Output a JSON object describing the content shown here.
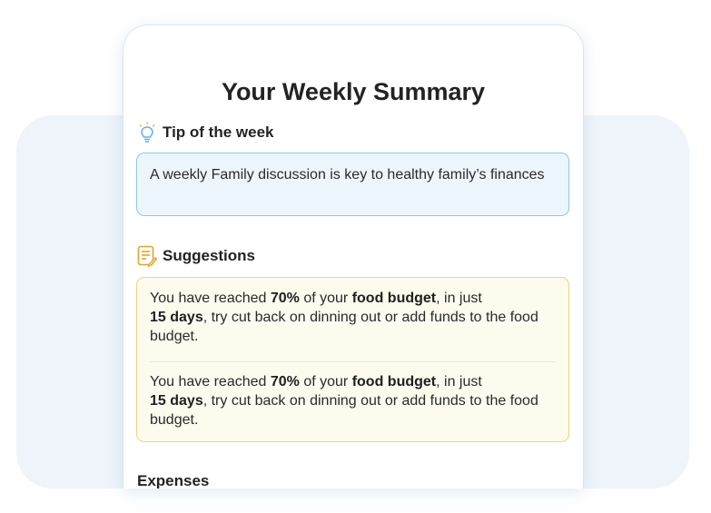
{
  "summary": {
    "title": "Your Weekly Summary"
  },
  "tip": {
    "heading": "Tip of the week",
    "icon": "lightbulb-icon",
    "text": "A weekly Family discussion is key to healthy family’s finances"
  },
  "suggestions": {
    "heading": "Suggestions",
    "icon": "notes-icon",
    "items": [
      {
        "t1": "You have reached ",
        "b1": "70%",
        "t2": " of your ",
        "b2": "food budget",
        "t3": ", in just",
        "b3": "15 days",
        "t4": ", try cut back on dinning out or add funds to the food budget."
      },
      {
        "t1": "You have reached ",
        "b1": "70%",
        "t2": " of your ",
        "b2": "food budget",
        "t3": ", in just",
        "b3": "15 days",
        "t4": ", try cut back on dinning out or add funds to the food budget."
      }
    ]
  },
  "expenses": {
    "heading": "Expenses"
  },
  "colors": {
    "tip_border": "#8cc8ea",
    "tip_background": "#eef6fd",
    "suggestion_border": "#ecd481",
    "suggestion_background": "#fdfbee",
    "page_background": "#eef4fa"
  }
}
